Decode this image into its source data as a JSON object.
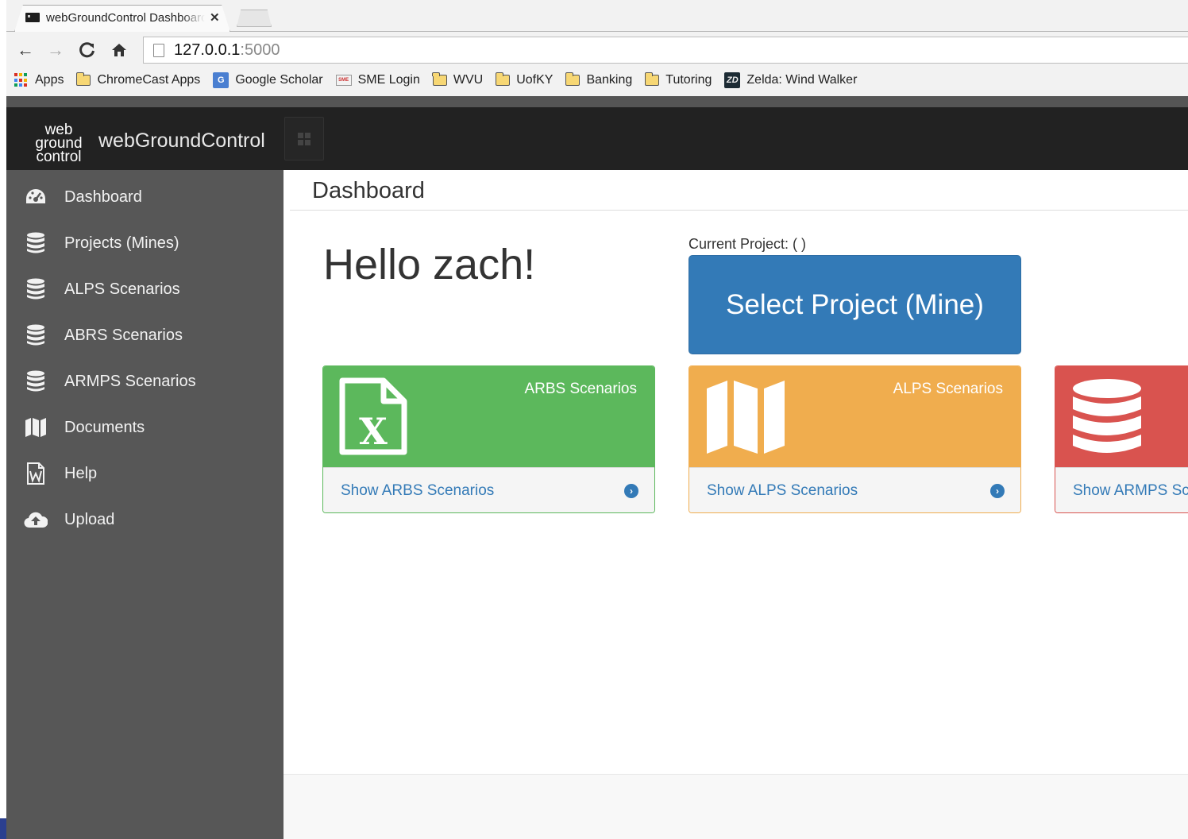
{
  "browser": {
    "tab_title": "webGroundControl Dashboard",
    "tab_close": "✕",
    "url_host": "127.0.0.1",
    "url_port": ":5000",
    "nav": {
      "back": "←",
      "forward": "→",
      "reload": "C",
      "home": "⌂"
    },
    "bookmarks": [
      {
        "label": "Apps",
        "icon": "apps-grid-icon"
      },
      {
        "label": "ChromeCast Apps",
        "icon": "folder-icon"
      },
      {
        "label": "Google Scholar",
        "icon": "google-scholar-icon",
        "icon_text": "G"
      },
      {
        "label": "SME Login",
        "icon": "sme-icon",
        "icon_text": "SME"
      },
      {
        "label": "WVU",
        "icon": "folder-icon"
      },
      {
        "label": "UofKY",
        "icon": "folder-icon"
      },
      {
        "label": "Banking",
        "icon": "folder-icon"
      },
      {
        "label": "Tutoring",
        "icon": "folder-icon"
      },
      {
        "label": "Zelda: Wind Walker",
        "icon": "zelda-icon",
        "icon_text": "ZD"
      }
    ]
  },
  "header": {
    "logo_lines": [
      "web",
      "ground",
      "control"
    ],
    "brand": "webGroundControl"
  },
  "sidebar": {
    "items": [
      {
        "label": "Dashboard",
        "icon": "dashboard-icon"
      },
      {
        "label": "Projects (Mines)",
        "icon": "database-icon"
      },
      {
        "label": "ALPS Scenarios",
        "icon": "database-icon"
      },
      {
        "label": "ABRS Scenarios",
        "icon": "database-icon"
      },
      {
        "label": "ARMPS Scenarios",
        "icon": "database-icon"
      },
      {
        "label": "Documents",
        "icon": "map-icon"
      },
      {
        "label": "Help",
        "icon": "word-file-icon"
      },
      {
        "label": "Upload",
        "icon": "cloud-upload-icon"
      }
    ]
  },
  "main": {
    "page_title": "Dashboard",
    "greeting": "Hello zach!",
    "current_project": "Current Project: ( )",
    "select_button": "Select Project (Mine)",
    "panels": [
      {
        "title": "ARBS Scenarios",
        "link": "Show ARBS Scenarios",
        "icon": "excel-file-icon",
        "color": "#5cb85c"
      },
      {
        "title": "ALPS Scenarios",
        "link": "Show ALPS Scenarios",
        "icon": "map-icon",
        "color": "#f0ad4e"
      },
      {
        "title": "",
        "link": "Show ARMPS Scenarios",
        "icon": "database-icon",
        "color": "#d9534f"
      }
    ]
  },
  "colors": {
    "primary": "#337ab7",
    "header_bg": "#222222",
    "sidebar_bg": "#575757"
  }
}
